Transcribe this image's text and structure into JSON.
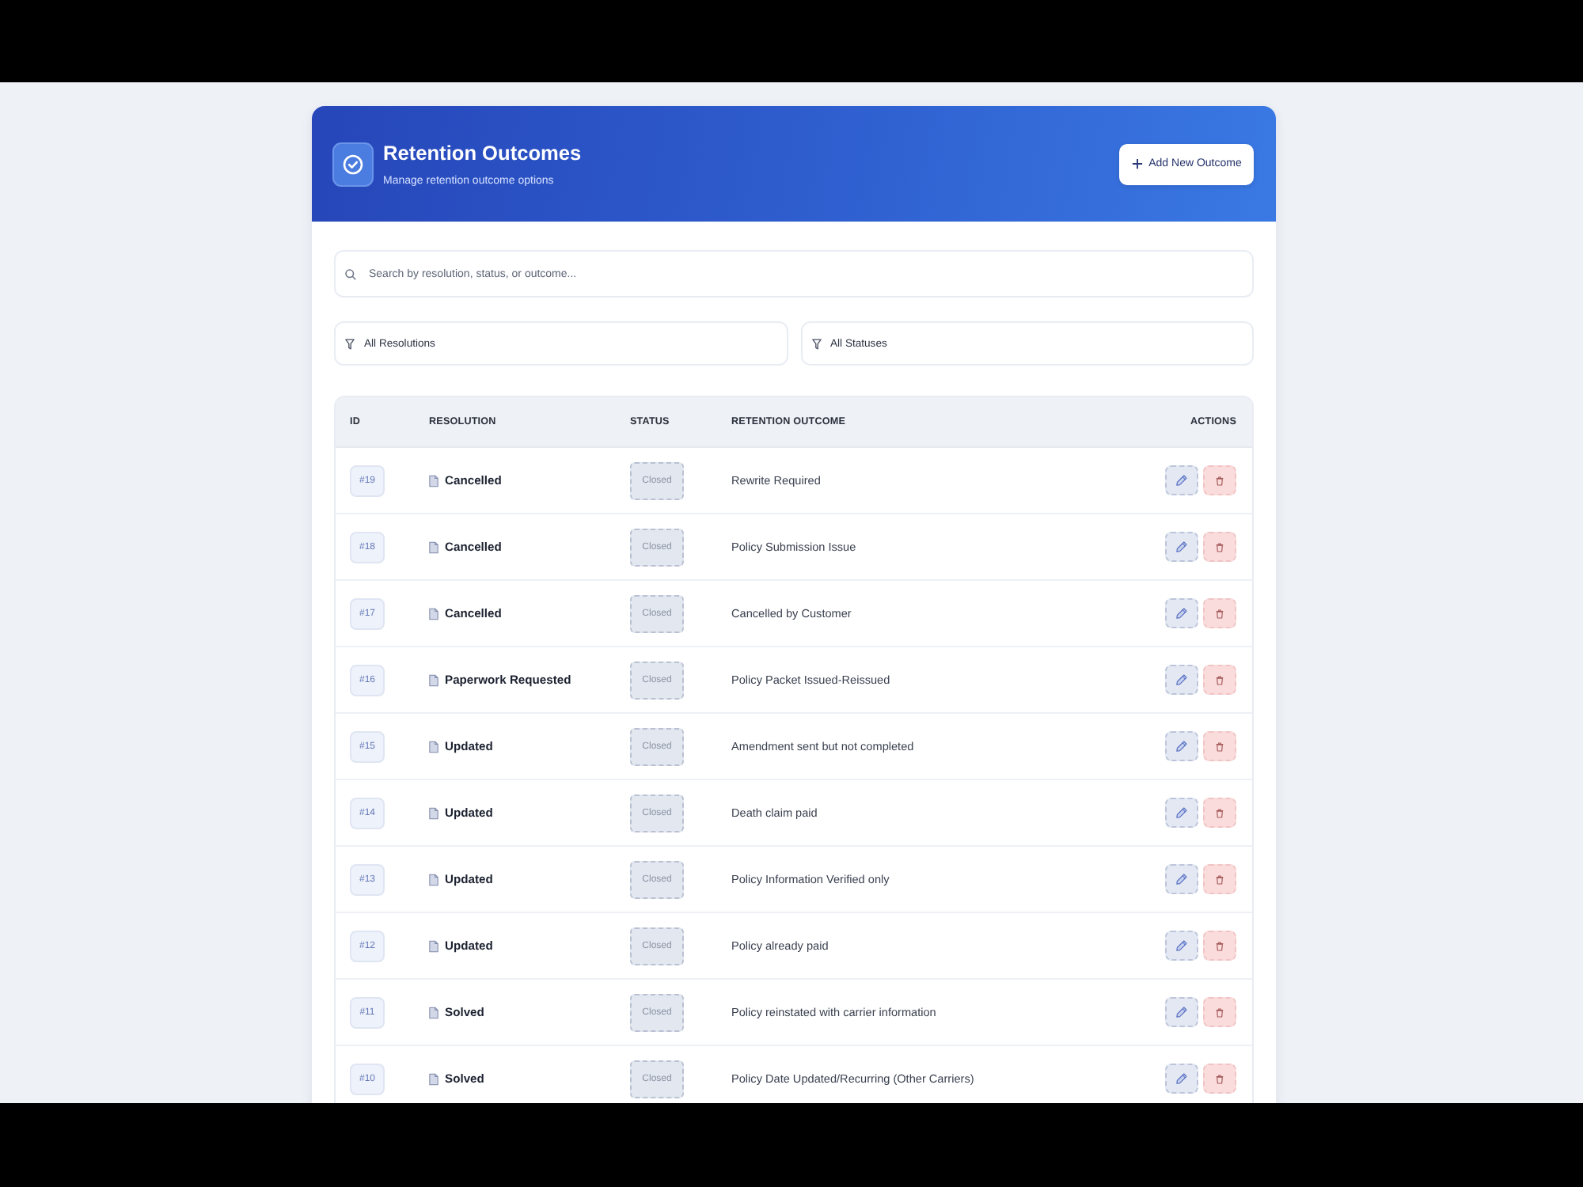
{
  "header": {
    "title": "Retention Outcomes",
    "subtitle": "Manage retention outcome options",
    "add_button": "Add New Outcome"
  },
  "search": {
    "placeholder": "Search by resolution, status, or outcome..."
  },
  "filters": [
    {
      "value": "All Resolutions"
    },
    {
      "value": "All Statuses"
    }
  ],
  "table": {
    "columns": [
      "ID",
      "RESOLUTION",
      "STATUS",
      "RETENTION OUTCOME",
      "ACTIONS"
    ],
    "rows": [
      {
        "id": "#19",
        "resolution": "Cancelled",
        "status": "Closed",
        "outcome": "Rewrite Required"
      },
      {
        "id": "#18",
        "resolution": "Cancelled",
        "status": "Closed",
        "outcome": "Policy Submission Issue"
      },
      {
        "id": "#17",
        "resolution": "Cancelled",
        "status": "Closed",
        "outcome": "Cancelled by Customer"
      },
      {
        "id": "#16",
        "resolution": "Paperwork Requested",
        "status": "Closed",
        "outcome": "Policy Packet Issued-Reissued"
      },
      {
        "id": "#15",
        "resolution": "Updated",
        "status": "Closed",
        "outcome": "Amendment sent but not completed"
      },
      {
        "id": "#14",
        "resolution": "Updated",
        "status": "Closed",
        "outcome": "Death claim paid"
      },
      {
        "id": "#13",
        "resolution": "Updated",
        "status": "Closed",
        "outcome": "Policy Information Verified only"
      },
      {
        "id": "#12",
        "resolution": "Updated",
        "status": "Closed",
        "outcome": "Policy already paid"
      },
      {
        "id": "#11",
        "resolution": "Solved",
        "status": "Closed",
        "outcome": "Policy reinstated with carrier information"
      },
      {
        "id": "#10",
        "resolution": "Solved",
        "status": "Closed",
        "outcome": "Policy Date Updated/Recurring (Other Carriers)"
      }
    ]
  }
}
